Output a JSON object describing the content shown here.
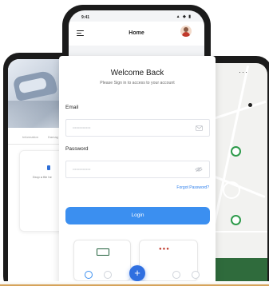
{
  "status_bar": {
    "time": "9:41"
  },
  "header": {
    "title": "Home"
  },
  "login": {
    "title": "Welcome Back",
    "subtitle": "Please Sign in to access to your account",
    "email_label": "Email",
    "password_label": "Password",
    "forgot_link": "Forgot Password?",
    "login_button": "Login"
  },
  "left_screen": {
    "tab_information": "Information",
    "tab_damage": "Damag",
    "drop_text": "Drop a file he"
  },
  "colors": {
    "accent_blue": "#3b8ff0",
    "fab_blue": "#2f6fe0",
    "map_green": "#2f6b3c",
    "pin_green": "#2e9b4b"
  },
  "icons": [
    "hamburger-menu-icon",
    "avatar",
    "mail-icon",
    "eye-off-icon",
    "plus-icon",
    "home-icon",
    "notification-icon",
    "map-pin-icon",
    "truck-icon",
    "people-icon"
  ]
}
